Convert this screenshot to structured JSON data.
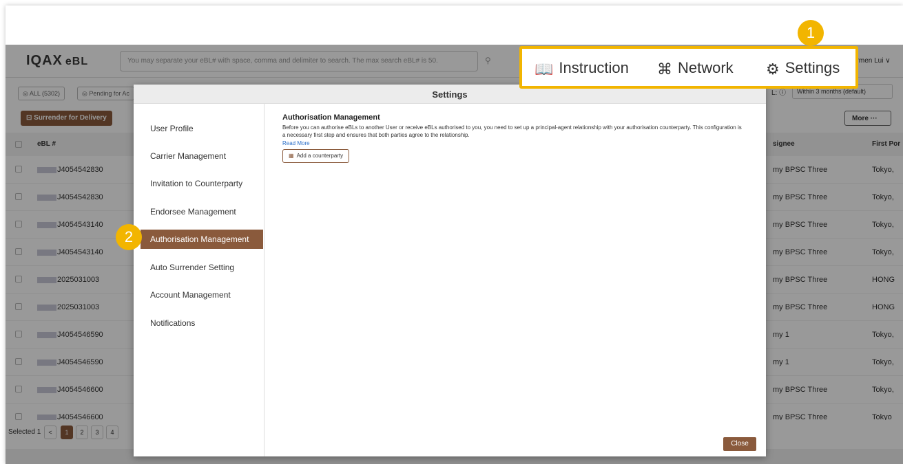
{
  "app": {
    "logo": "IQAX",
    "logo_suffix": "eBL",
    "search_placeholder": "You may separate your eBL# with space, comma and delimiter to search. The max search eBL# is 50.",
    "user": "armen Lui ∨",
    "tabs": [
      "◎ ALL (5302)",
      "◎ Pending for Ac"
    ],
    "bl_filter_label": "L: ⓘ",
    "bl_filter_value": "Within 3 months (default)",
    "surrender_button": "⊡ Surrender for Delivery",
    "more_button": "More ···",
    "columns": {
      "ebl": "eBL #",
      "consignee": "signee",
      "first_port": "First Por"
    },
    "rows": [
      {
        "ebl": "J4054542830",
        "consignee": "my BPSC Three",
        "port": "Tokyo,"
      },
      {
        "ebl": "J4054542830",
        "consignee": "my BPSC Three",
        "port": "Tokyo,"
      },
      {
        "ebl": "J4054543140",
        "consignee": "my BPSC Three",
        "port": "Tokyo,"
      },
      {
        "ebl": "J4054543140",
        "consignee": "my BPSC Three",
        "port": "Tokyo,"
      },
      {
        "ebl": "2025031003",
        "consignee": "my BPSC Three",
        "port": "HONG"
      },
      {
        "ebl": "2025031003",
        "consignee": "my BPSC Three",
        "port": "HONG"
      },
      {
        "ebl": "J4054546590",
        "consignee": "my 1",
        "port": "Tokyo,"
      },
      {
        "ebl": "J4054546590",
        "consignee": "my 1",
        "port": "Tokyo,"
      },
      {
        "ebl": "J4054546600",
        "consignee": "my BPSC Three",
        "port": "Tokyo,"
      },
      {
        "ebl": "J4054546600",
        "consignee": "my BPSC Three",
        "port": "Tokyo"
      }
    ],
    "pagination": {
      "label": "Selected 1",
      "prev": "<",
      "pages": [
        "1",
        "2",
        "3",
        "4"
      ]
    }
  },
  "modal": {
    "title": "Settings",
    "menu": [
      "User Profile",
      "Carrier Management",
      "Invitation to Counterparty",
      "Endorsee Management",
      "Authorisation Management",
      "Auto Surrender Setting",
      "Account Management",
      "Notifications"
    ],
    "active_index": 4,
    "body_title": "Authorisation Management",
    "body_desc": "Before you can authorise eBLs to another User or receive eBLs authorised to you, you need to set up a principal-agent relationship with your authorisation counterparty. This configuration is a necessary first step and ensures that both parties agree to the relationship.",
    "read_more": "Read More",
    "add_button": "Add a counterparty",
    "close_button": "Close"
  },
  "callout": {
    "instruction": "Instruction",
    "network": "Network",
    "settings": "Settings",
    "icons": [
      "book-icon",
      "network-icon",
      "gear-icon"
    ]
  },
  "badges": [
    "1",
    "2"
  ],
  "colors": {
    "accent": "#8a5a3c",
    "highlight": "#f2b500"
  }
}
